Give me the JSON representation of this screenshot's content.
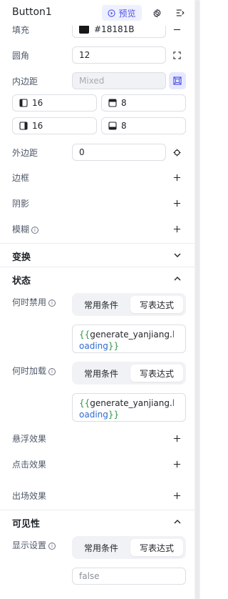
{
  "header": {
    "title": "Button1",
    "preview_label": "预览",
    "accent": "#4d53e8"
  },
  "fill": {
    "label": "填充",
    "value": "#18181B",
    "color": "#18181B"
  },
  "radius": {
    "label": "圆角",
    "value": "12"
  },
  "padding": {
    "label": "内边距",
    "placeholder": "Mixed",
    "left": "16",
    "top": "8",
    "right": "16",
    "bottom": "8"
  },
  "margin": {
    "label": "外边距",
    "value": "0"
  },
  "border": {
    "label": "边框"
  },
  "shadow": {
    "label": "阴影"
  },
  "blur": {
    "label": "模糊"
  },
  "transform_section": {
    "title": "变换"
  },
  "state_section": {
    "title": "状态",
    "disabled_when": {
      "label": "何时禁用",
      "options": [
        "常用条件",
        "写表达式"
      ],
      "active": "写表达式",
      "expr_open": "{{",
      "expr_obj": "generate_yanjiang.",
      "expr_prop": "loading",
      "expr_close": "}}"
    },
    "loading_when": {
      "label": "何时加载",
      "options": [
        "常用条件",
        "写表达式"
      ],
      "active": "写表达式",
      "expr_open": "{{",
      "expr_obj": "generate_yanjiang.",
      "expr_prop": "loading",
      "expr_close": "}}"
    },
    "hover_effect": {
      "label": "悬浮效果"
    },
    "click_effect": {
      "label": "点击效果"
    },
    "enter_effect": {
      "label": "出场效果"
    }
  },
  "visibility_section": {
    "title": "可见性",
    "display": {
      "label": "显示设置",
      "options": [
        "常用条件",
        "写表达式"
      ],
      "active": "写表达式",
      "value": "false"
    }
  }
}
